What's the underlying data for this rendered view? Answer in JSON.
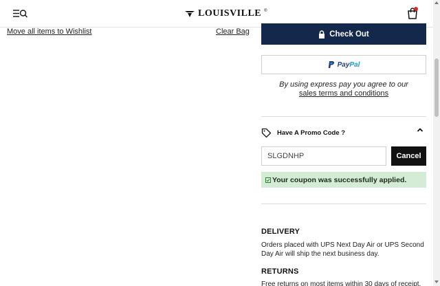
{
  "header": {
    "logo_text": "LOUISVILLE",
    "registered_mark": "®",
    "menu_icon": "menu-search-icon",
    "bag_icon": "shopping-bag-icon",
    "bag_badge_color": "#d62b2b"
  },
  "bag_actions": {
    "move_all_label": "Move all items to Wishlist",
    "clear_label": "Clear Bag"
  },
  "checkout": {
    "label": "Check Out",
    "lock_icon": "lock-icon",
    "color": "#13284a"
  },
  "paypal": {
    "pay": "Pay",
    "pal": "Pal"
  },
  "express_note": {
    "line1": "By using express pay you agree to our",
    "terms_link": "sales terms and conditions"
  },
  "promo": {
    "title": "Have A Promo Code ?",
    "tag_icon": "tag-icon",
    "chevron_icon": "chevron-up-icon",
    "code_value": "SLGDNHP",
    "cancel_label": "Cancel",
    "success_text": "Your coupon was successfully applied.",
    "success_color": "#d4ecd6"
  },
  "info": {
    "delivery_title": "DELIVERY",
    "delivery_text": "Orders placed with UPS Next Day Air or UPS Second Day Air will ship the next business day.",
    "returns_title": "RETURNS",
    "returns_text": "Free returns on most items within 30 days of receipt."
  }
}
